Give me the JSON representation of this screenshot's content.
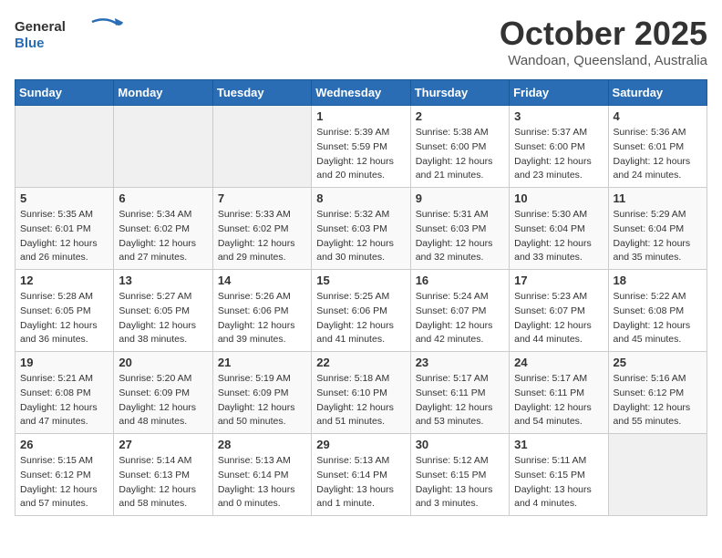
{
  "header": {
    "logo_general": "General",
    "logo_blue": "Blue",
    "month_year": "October 2025",
    "location": "Wandoan, Queensland, Australia"
  },
  "days_of_week": [
    "Sunday",
    "Monday",
    "Tuesday",
    "Wednesday",
    "Thursday",
    "Friday",
    "Saturday"
  ],
  "weeks": [
    [
      {
        "day": "",
        "empty": true
      },
      {
        "day": "",
        "empty": true
      },
      {
        "day": "",
        "empty": true
      },
      {
        "day": "1",
        "sunrise": "Sunrise: 5:39 AM",
        "sunset": "Sunset: 5:59 PM",
        "daylight": "Daylight: 12 hours and 20 minutes."
      },
      {
        "day": "2",
        "sunrise": "Sunrise: 5:38 AM",
        "sunset": "Sunset: 6:00 PM",
        "daylight": "Daylight: 12 hours and 21 minutes."
      },
      {
        "day": "3",
        "sunrise": "Sunrise: 5:37 AM",
        "sunset": "Sunset: 6:00 PM",
        "daylight": "Daylight: 12 hours and 23 minutes."
      },
      {
        "day": "4",
        "sunrise": "Sunrise: 5:36 AM",
        "sunset": "Sunset: 6:01 PM",
        "daylight": "Daylight: 12 hours and 24 minutes."
      }
    ],
    [
      {
        "day": "5",
        "sunrise": "Sunrise: 5:35 AM",
        "sunset": "Sunset: 6:01 PM",
        "daylight": "Daylight: 12 hours and 26 minutes."
      },
      {
        "day": "6",
        "sunrise": "Sunrise: 5:34 AM",
        "sunset": "Sunset: 6:02 PM",
        "daylight": "Daylight: 12 hours and 27 minutes."
      },
      {
        "day": "7",
        "sunrise": "Sunrise: 5:33 AM",
        "sunset": "Sunset: 6:02 PM",
        "daylight": "Daylight: 12 hours and 29 minutes."
      },
      {
        "day": "8",
        "sunrise": "Sunrise: 5:32 AM",
        "sunset": "Sunset: 6:03 PM",
        "daylight": "Daylight: 12 hours and 30 minutes."
      },
      {
        "day": "9",
        "sunrise": "Sunrise: 5:31 AM",
        "sunset": "Sunset: 6:03 PM",
        "daylight": "Daylight: 12 hours and 32 minutes."
      },
      {
        "day": "10",
        "sunrise": "Sunrise: 5:30 AM",
        "sunset": "Sunset: 6:04 PM",
        "daylight": "Daylight: 12 hours and 33 minutes."
      },
      {
        "day": "11",
        "sunrise": "Sunrise: 5:29 AM",
        "sunset": "Sunset: 6:04 PM",
        "daylight": "Daylight: 12 hours and 35 minutes."
      }
    ],
    [
      {
        "day": "12",
        "sunrise": "Sunrise: 5:28 AM",
        "sunset": "Sunset: 6:05 PM",
        "daylight": "Daylight: 12 hours and 36 minutes."
      },
      {
        "day": "13",
        "sunrise": "Sunrise: 5:27 AM",
        "sunset": "Sunset: 6:05 PM",
        "daylight": "Daylight: 12 hours and 38 minutes."
      },
      {
        "day": "14",
        "sunrise": "Sunrise: 5:26 AM",
        "sunset": "Sunset: 6:06 PM",
        "daylight": "Daylight: 12 hours and 39 minutes."
      },
      {
        "day": "15",
        "sunrise": "Sunrise: 5:25 AM",
        "sunset": "Sunset: 6:06 PM",
        "daylight": "Daylight: 12 hours and 41 minutes."
      },
      {
        "day": "16",
        "sunrise": "Sunrise: 5:24 AM",
        "sunset": "Sunset: 6:07 PM",
        "daylight": "Daylight: 12 hours and 42 minutes."
      },
      {
        "day": "17",
        "sunrise": "Sunrise: 5:23 AM",
        "sunset": "Sunset: 6:07 PM",
        "daylight": "Daylight: 12 hours and 44 minutes."
      },
      {
        "day": "18",
        "sunrise": "Sunrise: 5:22 AM",
        "sunset": "Sunset: 6:08 PM",
        "daylight": "Daylight: 12 hours and 45 minutes."
      }
    ],
    [
      {
        "day": "19",
        "sunrise": "Sunrise: 5:21 AM",
        "sunset": "Sunset: 6:08 PM",
        "daylight": "Daylight: 12 hours and 47 minutes."
      },
      {
        "day": "20",
        "sunrise": "Sunrise: 5:20 AM",
        "sunset": "Sunset: 6:09 PM",
        "daylight": "Daylight: 12 hours and 48 minutes."
      },
      {
        "day": "21",
        "sunrise": "Sunrise: 5:19 AM",
        "sunset": "Sunset: 6:09 PM",
        "daylight": "Daylight: 12 hours and 50 minutes."
      },
      {
        "day": "22",
        "sunrise": "Sunrise: 5:18 AM",
        "sunset": "Sunset: 6:10 PM",
        "daylight": "Daylight: 12 hours and 51 minutes."
      },
      {
        "day": "23",
        "sunrise": "Sunrise: 5:17 AM",
        "sunset": "Sunset: 6:11 PM",
        "daylight": "Daylight: 12 hours and 53 minutes."
      },
      {
        "day": "24",
        "sunrise": "Sunrise: 5:17 AM",
        "sunset": "Sunset: 6:11 PM",
        "daylight": "Daylight: 12 hours and 54 minutes."
      },
      {
        "day": "25",
        "sunrise": "Sunrise: 5:16 AM",
        "sunset": "Sunset: 6:12 PM",
        "daylight": "Daylight: 12 hours and 55 minutes."
      }
    ],
    [
      {
        "day": "26",
        "sunrise": "Sunrise: 5:15 AM",
        "sunset": "Sunset: 6:12 PM",
        "daylight": "Daylight: 12 hours and 57 minutes."
      },
      {
        "day": "27",
        "sunrise": "Sunrise: 5:14 AM",
        "sunset": "Sunset: 6:13 PM",
        "daylight": "Daylight: 12 hours and 58 minutes."
      },
      {
        "day": "28",
        "sunrise": "Sunrise: 5:13 AM",
        "sunset": "Sunset: 6:14 PM",
        "daylight": "Daylight: 13 hours and 0 minutes."
      },
      {
        "day": "29",
        "sunrise": "Sunrise: 5:13 AM",
        "sunset": "Sunset: 6:14 PM",
        "daylight": "Daylight: 13 hours and 1 minute."
      },
      {
        "day": "30",
        "sunrise": "Sunrise: 5:12 AM",
        "sunset": "Sunset: 6:15 PM",
        "daylight": "Daylight: 13 hours and 3 minutes."
      },
      {
        "day": "31",
        "sunrise": "Sunrise: 5:11 AM",
        "sunset": "Sunset: 6:15 PM",
        "daylight": "Daylight: 13 hours and 4 minutes."
      },
      {
        "day": "",
        "empty": true
      }
    ]
  ]
}
